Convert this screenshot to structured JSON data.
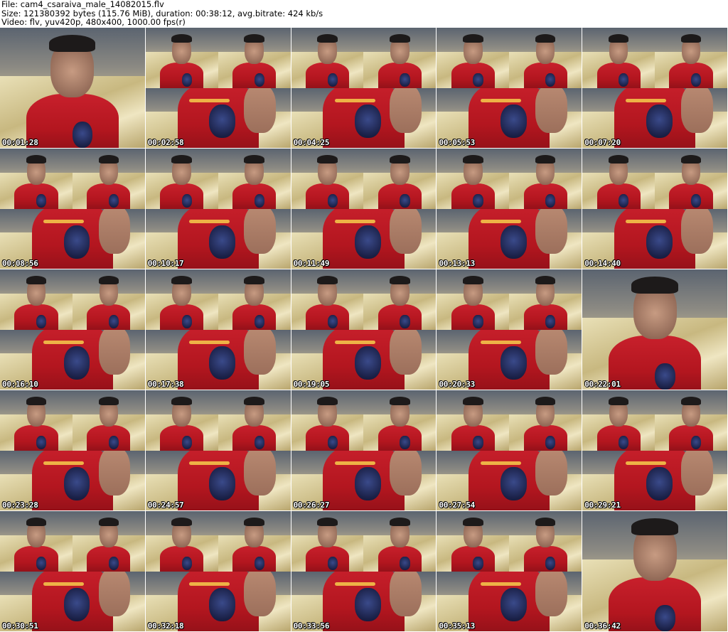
{
  "header": {
    "file_line": "File: cam4_csaraiva_male_14082015.flv",
    "size_line": "Size: 121380392 bytes (115.76 MiB), duration: 00:38:12, avg.bitrate: 424 kb/s",
    "video_line": "Video: flv, yuv420p, 480x400, 1000.00 fps(r)"
  },
  "thumbnails": [
    {
      "timestamp": "00:01:28",
      "kind": "closeup"
    },
    {
      "timestamp": "00:02:58",
      "kind": "quad"
    },
    {
      "timestamp": "00:04:25",
      "kind": "quad"
    },
    {
      "timestamp": "00:05:53",
      "kind": "quad"
    },
    {
      "timestamp": "00:07:20",
      "kind": "quad"
    },
    {
      "timestamp": "00:08:56",
      "kind": "quad"
    },
    {
      "timestamp": "00:10:17",
      "kind": "quad"
    },
    {
      "timestamp": "00:11:49",
      "kind": "quad"
    },
    {
      "timestamp": "00:13:13",
      "kind": "quad"
    },
    {
      "timestamp": "00:14:40",
      "kind": "quad"
    },
    {
      "timestamp": "00:16:10",
      "kind": "quad"
    },
    {
      "timestamp": "00:17:38",
      "kind": "quad"
    },
    {
      "timestamp": "00:19:05",
      "kind": "quad"
    },
    {
      "timestamp": "00:20:33",
      "kind": "quad"
    },
    {
      "timestamp": "00:22:01",
      "kind": "closeup"
    },
    {
      "timestamp": "00:23:28",
      "kind": "quad"
    },
    {
      "timestamp": "00:24:57",
      "kind": "quad"
    },
    {
      "timestamp": "00:26:27",
      "kind": "quad"
    },
    {
      "timestamp": "00:27:54",
      "kind": "quad"
    },
    {
      "timestamp": "00:29:21",
      "kind": "quad"
    },
    {
      "timestamp": "00:30:51",
      "kind": "quad"
    },
    {
      "timestamp": "00:32:18",
      "kind": "quad"
    },
    {
      "timestamp": "00:33:56",
      "kind": "quad"
    },
    {
      "timestamp": "00:35:13",
      "kind": "quad"
    },
    {
      "timestamp": "00:36:42",
      "kind": "closeup"
    }
  ]
}
